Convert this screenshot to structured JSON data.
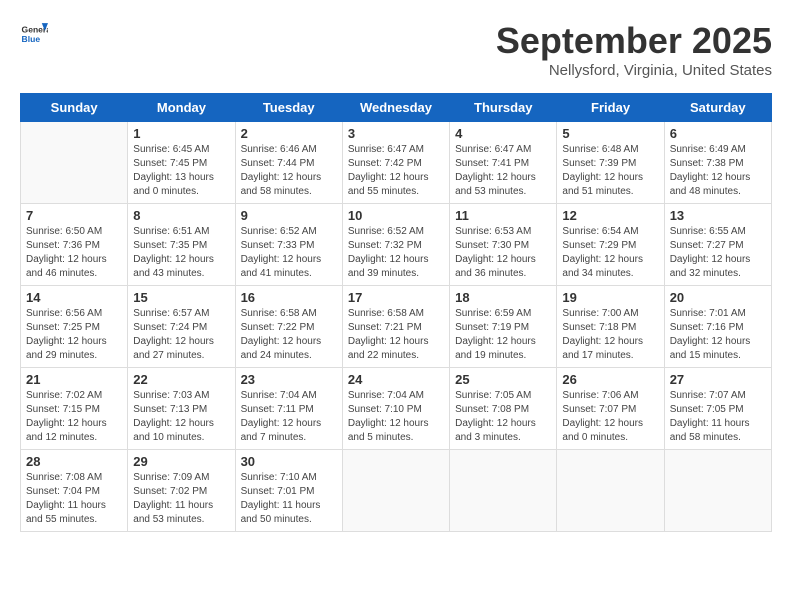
{
  "header": {
    "logo_line1": "General",
    "logo_line2": "Blue",
    "month": "September 2025",
    "location": "Nellysford, Virginia, United States"
  },
  "days_of_week": [
    "Sunday",
    "Monday",
    "Tuesday",
    "Wednesday",
    "Thursday",
    "Friday",
    "Saturday"
  ],
  "weeks": [
    [
      {
        "day": "",
        "info": ""
      },
      {
        "day": "1",
        "info": "Sunrise: 6:45 AM\nSunset: 7:45 PM\nDaylight: 13 hours\nand 0 minutes."
      },
      {
        "day": "2",
        "info": "Sunrise: 6:46 AM\nSunset: 7:44 PM\nDaylight: 12 hours\nand 58 minutes."
      },
      {
        "day": "3",
        "info": "Sunrise: 6:47 AM\nSunset: 7:42 PM\nDaylight: 12 hours\nand 55 minutes."
      },
      {
        "day": "4",
        "info": "Sunrise: 6:47 AM\nSunset: 7:41 PM\nDaylight: 12 hours\nand 53 minutes."
      },
      {
        "day": "5",
        "info": "Sunrise: 6:48 AM\nSunset: 7:39 PM\nDaylight: 12 hours\nand 51 minutes."
      },
      {
        "day": "6",
        "info": "Sunrise: 6:49 AM\nSunset: 7:38 PM\nDaylight: 12 hours\nand 48 minutes."
      }
    ],
    [
      {
        "day": "7",
        "info": "Sunrise: 6:50 AM\nSunset: 7:36 PM\nDaylight: 12 hours\nand 46 minutes."
      },
      {
        "day": "8",
        "info": "Sunrise: 6:51 AM\nSunset: 7:35 PM\nDaylight: 12 hours\nand 43 minutes."
      },
      {
        "day": "9",
        "info": "Sunrise: 6:52 AM\nSunset: 7:33 PM\nDaylight: 12 hours\nand 41 minutes."
      },
      {
        "day": "10",
        "info": "Sunrise: 6:52 AM\nSunset: 7:32 PM\nDaylight: 12 hours\nand 39 minutes."
      },
      {
        "day": "11",
        "info": "Sunrise: 6:53 AM\nSunset: 7:30 PM\nDaylight: 12 hours\nand 36 minutes."
      },
      {
        "day": "12",
        "info": "Sunrise: 6:54 AM\nSunset: 7:29 PM\nDaylight: 12 hours\nand 34 minutes."
      },
      {
        "day": "13",
        "info": "Sunrise: 6:55 AM\nSunset: 7:27 PM\nDaylight: 12 hours\nand 32 minutes."
      }
    ],
    [
      {
        "day": "14",
        "info": "Sunrise: 6:56 AM\nSunset: 7:25 PM\nDaylight: 12 hours\nand 29 minutes."
      },
      {
        "day": "15",
        "info": "Sunrise: 6:57 AM\nSunset: 7:24 PM\nDaylight: 12 hours\nand 27 minutes."
      },
      {
        "day": "16",
        "info": "Sunrise: 6:58 AM\nSunset: 7:22 PM\nDaylight: 12 hours\nand 24 minutes."
      },
      {
        "day": "17",
        "info": "Sunrise: 6:58 AM\nSunset: 7:21 PM\nDaylight: 12 hours\nand 22 minutes."
      },
      {
        "day": "18",
        "info": "Sunrise: 6:59 AM\nSunset: 7:19 PM\nDaylight: 12 hours\nand 19 minutes."
      },
      {
        "day": "19",
        "info": "Sunrise: 7:00 AM\nSunset: 7:18 PM\nDaylight: 12 hours\nand 17 minutes."
      },
      {
        "day": "20",
        "info": "Sunrise: 7:01 AM\nSunset: 7:16 PM\nDaylight: 12 hours\nand 15 minutes."
      }
    ],
    [
      {
        "day": "21",
        "info": "Sunrise: 7:02 AM\nSunset: 7:15 PM\nDaylight: 12 hours\nand 12 minutes."
      },
      {
        "day": "22",
        "info": "Sunrise: 7:03 AM\nSunset: 7:13 PM\nDaylight: 12 hours\nand 10 minutes."
      },
      {
        "day": "23",
        "info": "Sunrise: 7:04 AM\nSunset: 7:11 PM\nDaylight: 12 hours\nand 7 minutes."
      },
      {
        "day": "24",
        "info": "Sunrise: 7:04 AM\nSunset: 7:10 PM\nDaylight: 12 hours\nand 5 minutes."
      },
      {
        "day": "25",
        "info": "Sunrise: 7:05 AM\nSunset: 7:08 PM\nDaylight: 12 hours\nand 3 minutes."
      },
      {
        "day": "26",
        "info": "Sunrise: 7:06 AM\nSunset: 7:07 PM\nDaylight: 12 hours\nand 0 minutes."
      },
      {
        "day": "27",
        "info": "Sunrise: 7:07 AM\nSunset: 7:05 PM\nDaylight: 11 hours\nand 58 minutes."
      }
    ],
    [
      {
        "day": "28",
        "info": "Sunrise: 7:08 AM\nSunset: 7:04 PM\nDaylight: 11 hours\nand 55 minutes."
      },
      {
        "day": "29",
        "info": "Sunrise: 7:09 AM\nSunset: 7:02 PM\nDaylight: 11 hours\nand 53 minutes."
      },
      {
        "day": "30",
        "info": "Sunrise: 7:10 AM\nSunset: 7:01 PM\nDaylight: 11 hours\nand 50 minutes."
      },
      {
        "day": "",
        "info": ""
      },
      {
        "day": "",
        "info": ""
      },
      {
        "day": "",
        "info": ""
      },
      {
        "day": "",
        "info": ""
      }
    ]
  ]
}
